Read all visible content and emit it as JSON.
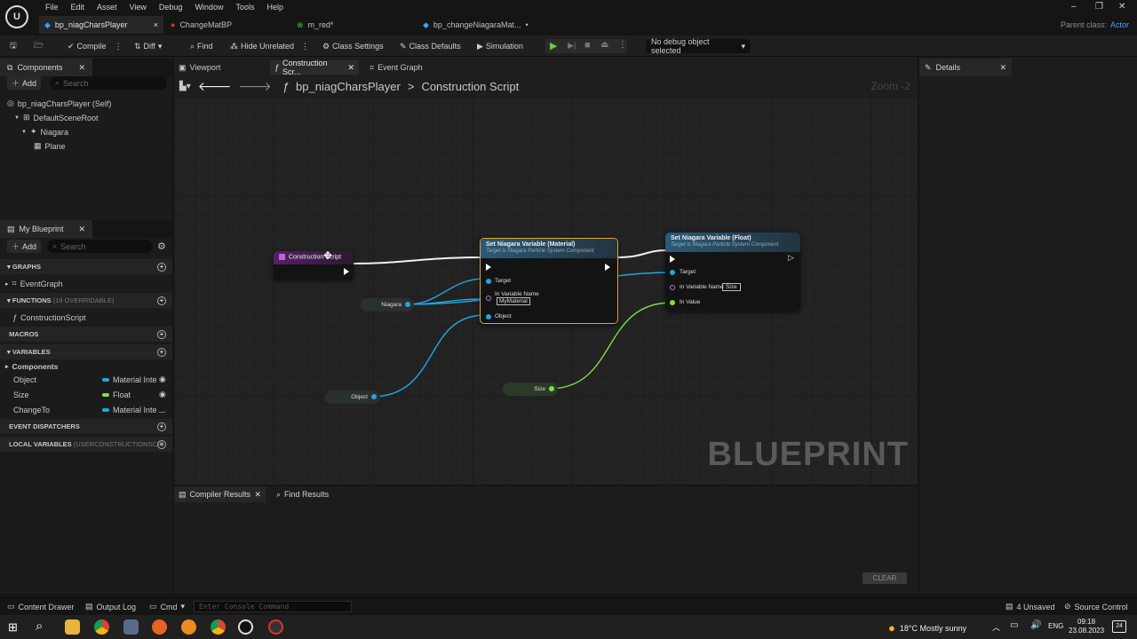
{
  "menu": [
    "File",
    "Edit",
    "Asset",
    "View",
    "Debug",
    "Window",
    "Tools",
    "Help"
  ],
  "doc_tabs": [
    {
      "label": "bp_niagCharsPlayer",
      "active": true,
      "close": "×"
    },
    {
      "label": "ChangeMatBP"
    },
    {
      "label": "m_red*"
    },
    {
      "label": "bp_changeNiagaraMat...",
      "close": "•"
    }
  ],
  "parent_class": {
    "label": "Parent class:",
    "value": "Actor"
  },
  "toolbar": {
    "compile": "Compile",
    "diff": "Diff",
    "find": "Find",
    "hide_unrelated": "Hide Unrelated",
    "class_settings": "Class Settings",
    "class_defaults": "Class Defaults",
    "simulation": "Simulation",
    "debug_object": "No debug object selected"
  },
  "components_panel": {
    "title": "Components",
    "add": "Add",
    "search_placeholder": "Search",
    "tree": [
      "bp_niagCharsPlayer (Self)",
      "DefaultSceneRoot",
      "Niagara",
      "Plane"
    ]
  },
  "myblueprint": {
    "title": "My Blueprint",
    "add": "Add",
    "search_placeholder": "Search",
    "graphs": "GRAPHS",
    "event_graph": "EventGraph",
    "functions": "FUNCTIONS",
    "functions_note": "(19 OVERRIDABLE)",
    "construction_script": "ConstructionScript",
    "macros": "MACROS",
    "variables": "VARIABLES",
    "components_cat": "Components",
    "vars": [
      {
        "name": "Object",
        "type": "Material Inte",
        "color": "#1ea7e1"
      },
      {
        "name": "Size",
        "type": "Float",
        "color": "#7ee03a"
      },
      {
        "name": "ChangeTo",
        "type": "Material Inte",
        "color": "#1ea7e1"
      }
    ],
    "event_dispatchers": "EVENT DISPATCHERS",
    "local_variables": "LOCAL VARIABLES",
    "local_note": "(USERCONSTRUCTIONSCRI"
  },
  "center_tabs": [
    "Viewport",
    "Construction Scr...",
    "Event Graph"
  ],
  "breadcrumb": {
    "bp": "bp_niagCharsPlayer",
    "sep": ">",
    "graph": "Construction Script",
    "zoom": "Zoom -2"
  },
  "nodes": {
    "construction": "Construction Script",
    "setmat_title": "Set Niagara Variable (Material)",
    "setmat_sub": "Target is Niagara Particle System Component",
    "setmat_target": "Target",
    "setmat_inname": "In Variable Name",
    "setmat_value": "MyMaterial",
    "setmat_object": "Object",
    "setfloat_title": "Set Niagara Variable (Float)",
    "setfloat_sub": "Target is Niagara Particle System Component",
    "setfloat_target": "Target",
    "setfloat_inname": "In Variable Name",
    "setfloat_value": "Size",
    "setfloat_invalue": "In Value",
    "var_niagara": "Niagara",
    "var_object": "Object",
    "var_size": "Size"
  },
  "watermark": "BLUEPRINT",
  "details": {
    "title": "Details"
  },
  "bottom_tabs": {
    "compiler": "Compiler Results",
    "find": "Find Results",
    "clear": "CLEAR"
  },
  "statusbar": {
    "content_drawer": "Content Drawer",
    "output_log": "Output Log",
    "cmd": "Cmd",
    "console_placeholder": "Enter Console Command",
    "unsaved": "4 Unsaved",
    "source_control": "Source Control"
  },
  "taskbar": {
    "weather": "18°C  Mostly sunny",
    "lang": "ENG",
    "time": "09:18",
    "date": "23.08.2023",
    "notif": "24"
  }
}
